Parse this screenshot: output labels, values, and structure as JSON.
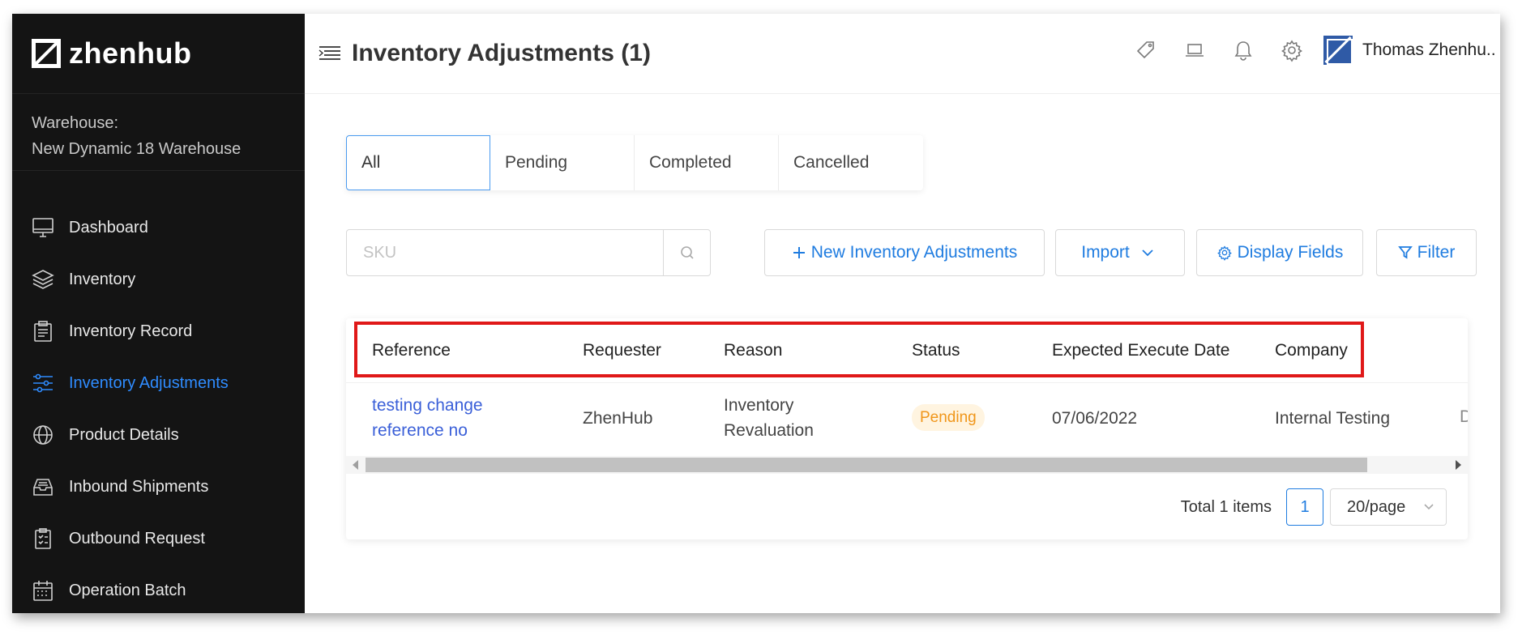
{
  "brand": {
    "name": "zhenhub"
  },
  "warehouse": {
    "label": "Warehouse:",
    "name": "New Dynamic 18 Warehouse"
  },
  "sidebar": {
    "items": [
      {
        "label": "Dashboard",
        "icon": "monitor-icon",
        "active": false
      },
      {
        "label": "Inventory",
        "icon": "layers-icon",
        "active": false
      },
      {
        "label": "Inventory Record",
        "icon": "clipboard-record-icon",
        "active": false
      },
      {
        "label": "Inventory Adjustments",
        "icon": "sliders-icon",
        "active": true
      },
      {
        "label": "Product Details",
        "icon": "globe-icon",
        "active": false
      },
      {
        "label": "Inbound Shipments",
        "icon": "inbox-icon",
        "active": false
      },
      {
        "label": "Outbound Request",
        "icon": "checklist-icon",
        "active": false
      },
      {
        "label": "Operation Batch",
        "icon": "calendar-icon",
        "active": false
      }
    ]
  },
  "header": {
    "title": "Inventory Adjustments (1)",
    "user_name": "Thomas Zhenhu..",
    "icons": [
      "tag-icon",
      "laptop-icon",
      "bell-icon",
      "gear-icon"
    ]
  },
  "tabs": [
    {
      "label": "All",
      "active": true
    },
    {
      "label": "Pending",
      "active": false
    },
    {
      "label": "Completed",
      "active": false
    },
    {
      "label": "Cancelled",
      "active": false
    }
  ],
  "search": {
    "placeholder": "SKU",
    "value": ""
  },
  "toolbar": {
    "new_label": "New Inventory Adjustments",
    "import_label": "Import",
    "display_fields_label": "Display Fields",
    "filter_label": "Filter"
  },
  "table": {
    "columns": [
      "Reference",
      "Requester",
      "Reason",
      "Status",
      "Expected Execute Date",
      "Company"
    ],
    "rows": [
      {
        "reference_line1": "testing change",
        "reference_line2": "reference no",
        "requester": "ZhenHub",
        "reason_line1": "Inventory",
        "reason_line2": "Revaluation",
        "status": "Pending",
        "expected_execute_date": "07/06/2022",
        "company": "Internal Testing",
        "overflow": "D"
      }
    ]
  },
  "pagination": {
    "total_label": "Total 1 items",
    "current_page": "1",
    "page_size": "20/page"
  },
  "colors": {
    "accent": "#1f7ce0",
    "sidebar_bg": "#141414",
    "active_nav": "#2f8cff",
    "highlight": "#e01818",
    "pending": "#f0961a"
  }
}
